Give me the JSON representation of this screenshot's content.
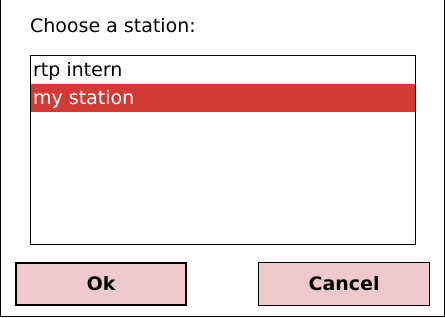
{
  "dialog": {
    "prompt": "Choose a station:"
  },
  "stations": {
    "items": [
      {
        "label": "rtp intern",
        "selected": false
      },
      {
        "label": "my station",
        "selected": true
      }
    ]
  },
  "buttons": {
    "ok_label": "Ok",
    "cancel_label": "Cancel"
  },
  "colors": {
    "selection": "#d23a37",
    "button_face": "#f0c9cc"
  }
}
